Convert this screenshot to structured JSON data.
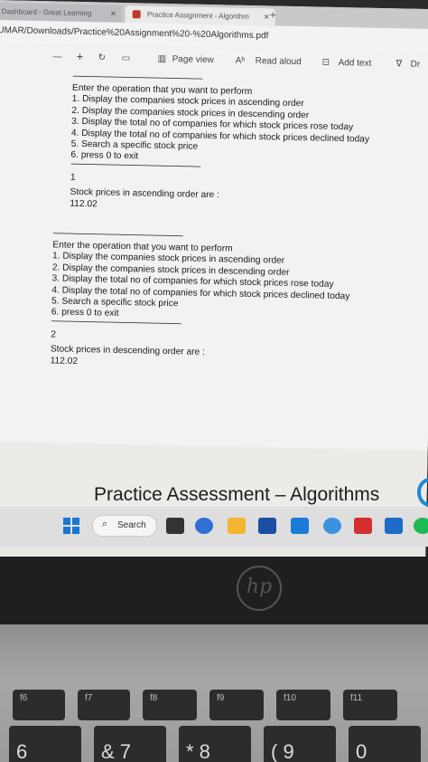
{
  "browser": {
    "tabs": [
      {
        "label": "Dashboard - Great Learning"
      },
      {
        "label": "Practice Assignment - Algorithm"
      }
    ],
    "new_tab": "+",
    "url": "UMAR/Downloads/Practice%20Assignment%20-%20Algorithms.pdf"
  },
  "pdf_toolbar": {
    "minus": "—",
    "plus": "+",
    "page_view": "Page view",
    "read_aloud": "Read aloud",
    "add_text": "Add text",
    "draw": "Dr"
  },
  "menu_blocks": [
    {
      "prompt": "Enter the operation that you want to perform",
      "options": [
        "1. Display the companies stock prices in ascending order",
        "2. Display the companies stock prices in descending order",
        "3. Display the total  no of companies  for which stock prices rose today",
        "4. Display the total  no of companies  for which stock prices declined today",
        "5. Search a specific stock price",
        "6. press 0 to exit"
      ],
      "input": "1",
      "result_label": "Stock prices in ascending order are :",
      "result_value": "112.02"
    },
    {
      "prompt": "Enter the operation that you want to perform",
      "options": [
        "1. Display the companies stock prices in ascending order",
        "2. Display the companies stock prices in descending order",
        "3. Display the total  no of companies  for which stock prices rose today",
        "4. Display the total  no of companies  for which stock prices declined today",
        "5. Search a specific stock price",
        "6. press 0 to exit"
      ],
      "input": "2",
      "result_label": "Stock prices in descending order are :",
      "result_value": "112.02"
    }
  ],
  "dashes": "------------------------------------------------------------",
  "document_title": "Practice Assessment – Algorithms",
  "taskbar": {
    "search_label": "Search"
  },
  "laptop": {
    "logo": "hp",
    "keys": [
      "f6",
      "f7",
      "f8",
      "f9",
      "f10",
      "f11",
      "6",
      "&\n7",
      "*\n8",
      "(\n9",
      "0"
    ]
  }
}
